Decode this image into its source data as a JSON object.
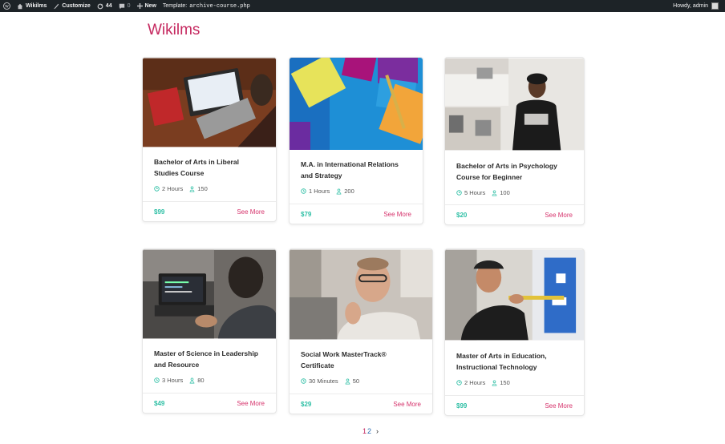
{
  "admin_bar": {
    "site_name": "Wikilms",
    "customize": "Customize",
    "updates_count": "44",
    "comments_count": "0",
    "new_label": "New",
    "template_label": "Template:",
    "template_file": "archive-course.php",
    "greeting": "Howdy, admin"
  },
  "page": {
    "title": "Wikilms"
  },
  "courses": [
    {
      "title": "Bachelor of Arts in Liberal Studies Course",
      "duration": "2 Hours",
      "students": "150",
      "price": "$99",
      "link": "See More"
    },
    {
      "title": "M.A. in International Relations and Strategy",
      "duration": "1 Hours",
      "students": "200",
      "price": "$79",
      "link": "See More"
    },
    {
      "title": "Bachelor of Arts in Psychology Course for Beginner",
      "duration": "5 Hours",
      "students": "100",
      "price": "$20",
      "link": "See More"
    },
    {
      "title": "Master of Science in Leadership and Resource",
      "duration": "3 Hours",
      "students": "80",
      "price": "$49",
      "link": "See More"
    },
    {
      "title": "Social Work MasterTrack® Certificate",
      "duration": "30 Minutes",
      "students": "50",
      "price": "$29",
      "link": "See More"
    },
    {
      "title": "Master of Arts in Education, Instructional Technology",
      "duration": "2 Hours",
      "students": "150",
      "price": "$99",
      "link": "See More"
    }
  ],
  "pagination": {
    "current": "1",
    "next_page": "2",
    "next_arrow": "›"
  },
  "colors": {
    "brand": "#c5285f",
    "price": "#2ebfa5",
    "link": "#d6336c",
    "meta_icon": "#2ebfa5"
  }
}
